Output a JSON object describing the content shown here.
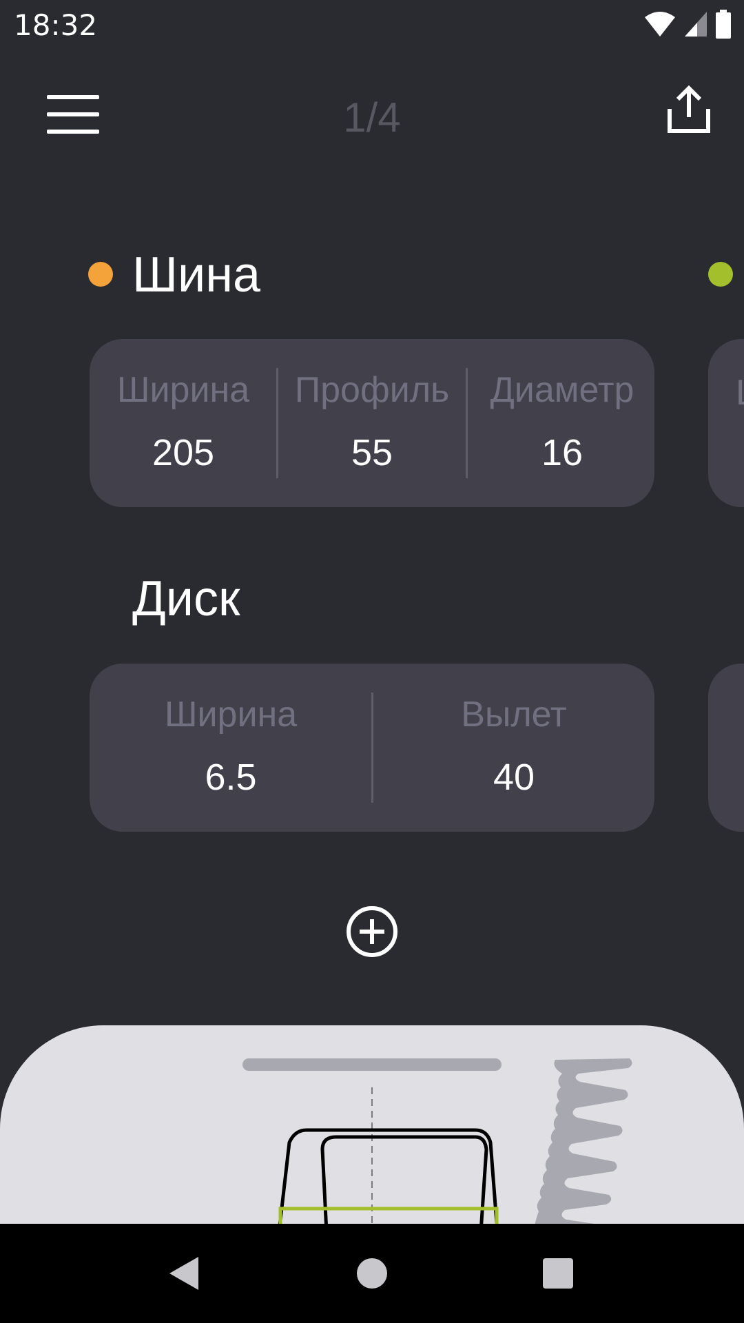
{
  "status_bar": {
    "time": "18:32"
  },
  "header": {
    "page_indicator": "1/4"
  },
  "tire": {
    "title": "Шина",
    "dot_color": "#f4a23a",
    "fields": [
      {
        "label": "Ширина",
        "value": "205"
      },
      {
        "label": "Профиль",
        "value": "55"
      },
      {
        "label": "Диаметр",
        "value": "16"
      }
    ]
  },
  "disc": {
    "title": "Диск",
    "fields": [
      {
        "label": "Ширина",
        "value": "6.5"
      },
      {
        "label": "Вылет",
        "value": "40"
      }
    ]
  },
  "next_card": {
    "dot_color": "#a4bf2c",
    "peek_label": "Ш"
  },
  "colors": {
    "background": "#2a2a31",
    "card": "#41404b",
    "muted_text": "#707080",
    "accent_green": "#a4bf2c",
    "panel": "#e0e0e4"
  },
  "icons": {
    "menu": "menu-icon",
    "share": "share-icon",
    "add": "add-circle-icon",
    "back": "back-triangle-icon",
    "home": "home-circle-icon",
    "recents": "recents-square-icon"
  }
}
